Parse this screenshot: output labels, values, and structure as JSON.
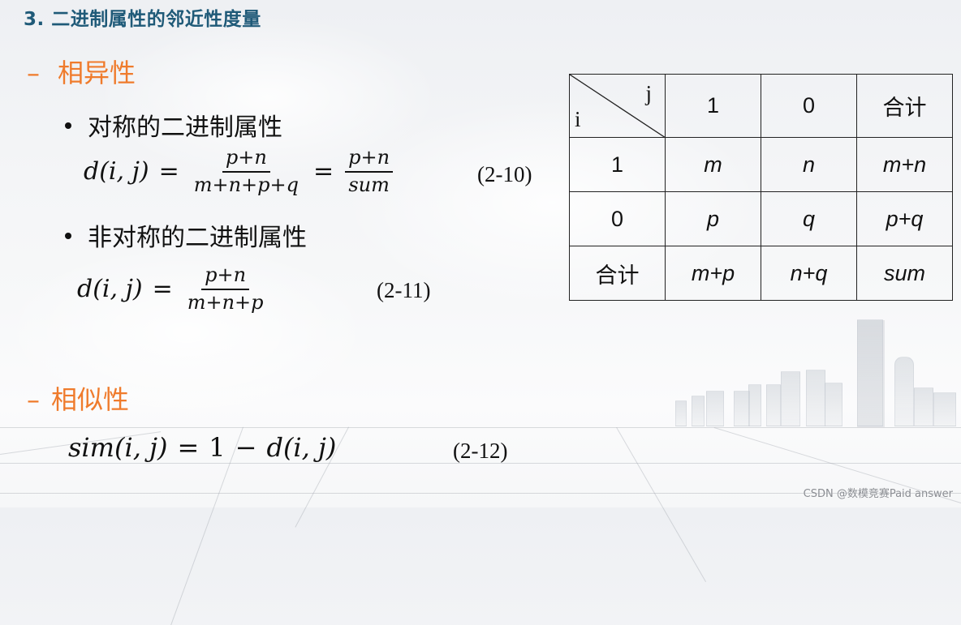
{
  "slide": {
    "title": "3. 二进制属性的邻近性度量",
    "accent_color": "#ef7b2c",
    "title_color": "#1f5a78",
    "dissimilarity": {
      "dash": "–",
      "label": "相异性",
      "symmetric": {
        "bullet": "对称的二进制属性",
        "lhs": "d(i, j)",
        "eq": "=",
        "frac1_num": "p+n",
        "frac1_den": "m+n+p+q",
        "frac2_num": "p+n",
        "frac2_den": "sum",
        "eq_number": "(2-10)"
      },
      "asymmetric": {
        "bullet": "非对称的二进制属性",
        "lhs": "d(i, j)",
        "eq": "=",
        "frac_num": "p+n",
        "frac_den": "m+n+p",
        "eq_number": "(2-11)"
      }
    },
    "similarity": {
      "dash": "–",
      "label": "相似性",
      "formula_lhs": "sim(i, j)",
      "eq": "=",
      "formula_rhs_one": "1",
      "minus": "−",
      "formula_rhs_d": "d(i, j)",
      "eq_number": "(2-12)"
    },
    "table": {
      "corner_row_label": "i",
      "corner_col_label": "j",
      "column_headers": [
        "1",
        "0",
        "合计"
      ],
      "rows": [
        {
          "label": "1",
          "cells": [
            "m",
            "n",
            "m+n"
          ]
        },
        {
          "label": "0",
          "cells": [
            "p",
            "q",
            "p+q"
          ]
        },
        {
          "label": "合计",
          "cells": [
            "m+p",
            "n+q",
            "sum"
          ]
        }
      ]
    }
  },
  "watermark": "CSDN @数模竞赛Paid answer"
}
